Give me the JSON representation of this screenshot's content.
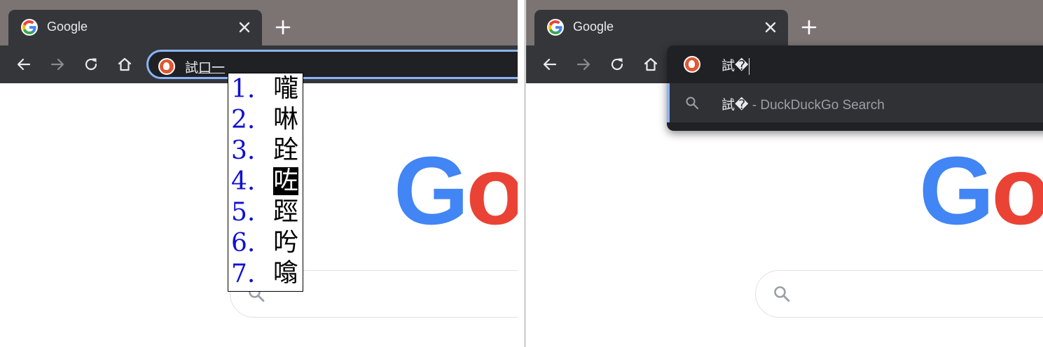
{
  "left": {
    "tab_title": "Google",
    "omnibox_text": "試",
    "omnibox_composing": "口一",
    "ime_candidates": [
      {
        "num": "1.",
        "char": "嚨"
      },
      {
        "num": "2.",
        "char": "啉"
      },
      {
        "num": "3.",
        "char": "跧"
      },
      {
        "num": "4.",
        "char": "咗"
      },
      {
        "num": "5.",
        "char": "踁"
      },
      {
        "num": "6.",
        "char": "𠯋"
      },
      {
        "num": "7.",
        "char": "噏"
      }
    ],
    "ime_selected_index": 3,
    "logo_letters": [
      "G",
      "o"
    ]
  },
  "right": {
    "tab_title": "Google",
    "omnibox_text": "試�",
    "suggestion_query": "試�",
    "suggestion_suffix": " - DuckDuckGo Search",
    "logo_letters": [
      "G",
      "o"
    ]
  },
  "colors": {
    "tab_strip": "#7b7473",
    "toolbar": "#35363a",
    "omnibox_focus": "#8ab4f8",
    "ime_number": "#1010d0",
    "google_blue": "#4285f4",
    "google_red": "#ea4335"
  },
  "icons": [
    "google-favicon",
    "close-icon",
    "plus-icon",
    "back-arrow-icon",
    "forward-arrow-icon",
    "reload-icon",
    "home-icon",
    "duckduckgo-icon",
    "search-icon"
  ]
}
